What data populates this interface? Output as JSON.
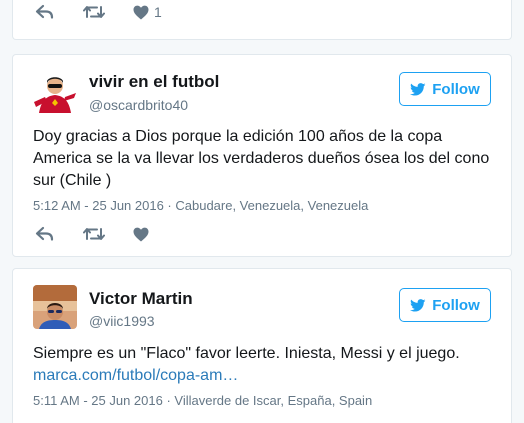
{
  "colors": {
    "accent": "#1da1f2",
    "link": "#2b7bb9",
    "muted": "#657786",
    "text": "#14171a",
    "border": "#e1e8ed",
    "background": "#f5f8fa"
  },
  "tweets": [
    {
      "actions": {
        "reply_icon": "reply-icon",
        "retweet_icon": "retweet-icon",
        "like_icon": "heart-icon",
        "like_count": "1"
      }
    },
    {
      "author": {
        "name": "vivir en el futbol",
        "handle": "@oscardbrito40"
      },
      "follow_label": "Follow",
      "follow_icon": "twitter-bird-icon",
      "text": "Doy gracias a Dios porque la edición 100 años de la copa Americа se la va llevar los verdaderos dueños ósea los del cono sur (Chile )",
      "meta": "5:12 AM - 25 Jun 2016 · Cabudare, Venezuela, Venezuela",
      "actions": {
        "reply_icon": "reply-icon",
        "retweet_icon": "retweet-icon",
        "like_icon": "heart-icon"
      }
    },
    {
      "author": {
        "name": "Victor Martin",
        "handle": "@viic1993"
      },
      "follow_label": "Follow",
      "follow_icon": "twitter-bird-icon",
      "text": "Siempre es un \"Flaco\" favor leerte. Iniesta, Messi y el juego.",
      "link": "marca.com/futbol/copa-am…",
      "meta": "5:11 AM - 25 Jun 2016 · Villaverde de Iscar, España, Spain"
    }
  ]
}
